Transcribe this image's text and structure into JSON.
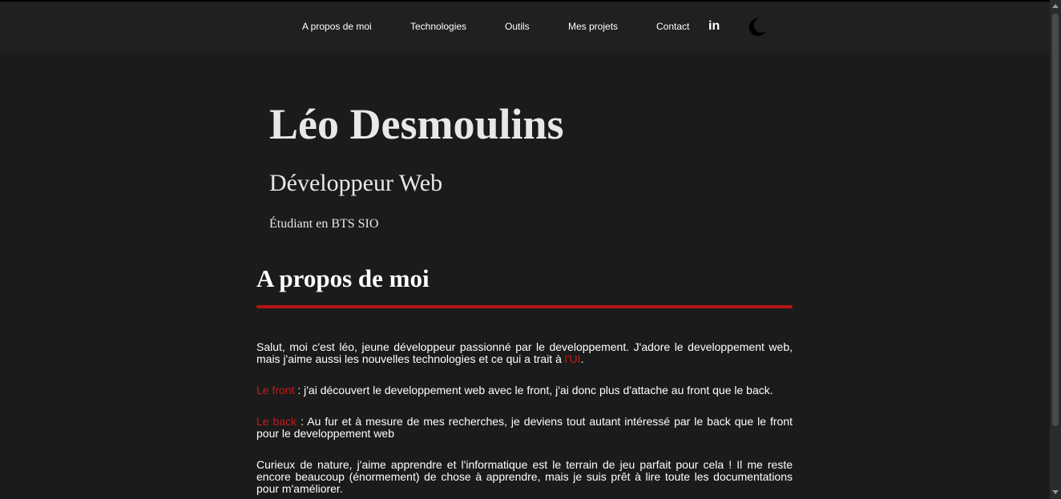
{
  "nav": {
    "links": [
      "A propos de moi",
      "Technologies",
      "Outils",
      "Mes projets",
      "Contact"
    ],
    "linkedin_text": "in",
    "linkedin_icon": "linkedin-icon",
    "theme_icon": "moon-icon"
  },
  "hero": {
    "name": "Léo Desmoulins",
    "role": "Développeur Web",
    "status": "Étudiant en BTS SIO"
  },
  "about": {
    "title": "A propos de moi",
    "p1_text": "Salut, moi c'est léo, jeune développeur passionné par le developpement. J'adore le developpement web, mais j'aime aussi les nouvelles technologies et ce qui a trait à ",
    "p1_highlight": "l'UI",
    "p1_end": ".",
    "p2_highlight": "Le front",
    "p2_text": " : j'ai découvert le developpement web avec le front, j'ai donc plus d'attache au front que le back.",
    "p3_highlight": "Le back",
    "p3_text": " : Au fur et à mesure de mes recherches, je deviens tout autant intéressé par le back que le front pour le developpement web",
    "p4_text": "Curieux de nature, j'aime apprendre et l'informatique est le terrain de jeu parfait pour cela ! Il me reste encore beaucoup (énormement) de chose à apprendre, mais je suis prêt à lire toute les documentations pour m'améliorer."
  },
  "colors": {
    "background": "#1b1b1b",
    "navbar": "#202020",
    "accent": "#c41a1a",
    "divider": "#b31414"
  }
}
